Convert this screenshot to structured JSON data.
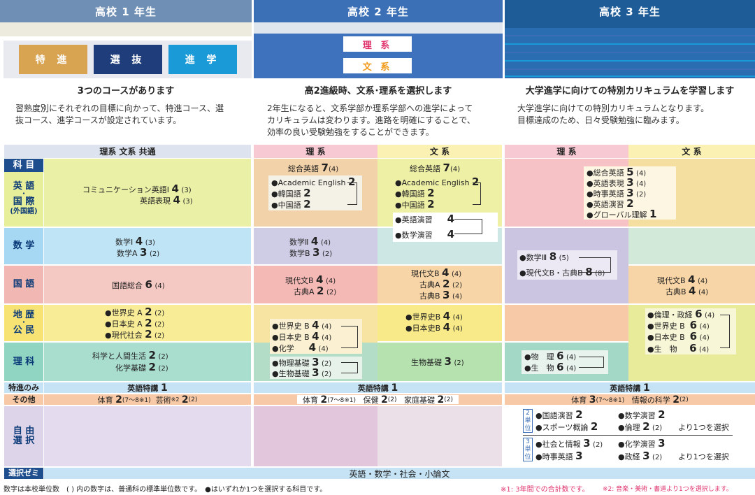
{
  "headers": [
    "高校 1 年生",
    "高校 2 年生",
    "高校 3 年生"
  ],
  "courses": [
    "特 進",
    "選 抜",
    "進 学"
  ],
  "tracks": {
    "rikei": "理 系",
    "bunkei": "文 系"
  },
  "intro": [
    {
      "title": "3つのコースがあります",
      "text": [
        "習熟度別にそれぞれの目標に向かって、特進コース、選",
        "抜コース、進学コースが設定されています。"
      ]
    },
    {
      "title": "高2進級時、文系･理系を選択します",
      "text": [
        "2年生になると、文系学部か理系学部への進学によって",
        "カリキュラムは変わります。進路を明確にすることで、",
        "効率の良い受験勉強をすることができます。"
      ]
    },
    {
      "title": "大学進学に向けての特別カリキュラムを学習します",
      "text": [
        "大学進学に向けての特別カリキュラムとなります。",
        "目標達成のため、日々受験勉強に臨みます。"
      ]
    }
  ],
  "table": {
    "g1_header": "理系 文系 共通",
    "rikei": "理 系",
    "bunkei": "文 系",
    "subject_header": "科 目",
    "subjects": {
      "english": [
        "英 語",
        "国 際",
        "(外国語)"
      ],
      "math": "数 学",
      "japanese": "国 語",
      "social": [
        "地 歴",
        "公 民"
      ],
      "science": "理 科",
      "tokushin": "特進のみ",
      "other": "その他",
      "free": [
        "自 由",
        "選 択"
      ],
      "seminar": "選択ゼミ"
    },
    "g1": {
      "english": [
        {
          "name": "コミュニケーション英語Ⅰ",
          "u": "4",
          "s": "(3)"
        },
        {
          "name": "英語表現",
          "u": "4",
          "s": "(3)"
        }
      ],
      "math": [
        {
          "name": "数学Ⅰ",
          "u": "4",
          "s": "(3)"
        },
        {
          "name": "数学A",
          "u": "3",
          "s": "(2)"
        }
      ],
      "japanese": [
        {
          "name": "国語総合",
          "u": "6",
          "s": "(4)"
        }
      ],
      "social": [
        {
          "name": "●世界史 A",
          "u": "2",
          "s": "(2)"
        },
        {
          "name": "●日本史 A",
          "u": "2",
          "s": "(2)"
        },
        {
          "name": "●現代社会",
          "u": "2",
          "s": "(2)"
        }
      ],
      "science": [
        {
          "name": "科学と人間生活",
          "u": "2",
          "s": "(2)"
        },
        {
          "name": "化学基礎",
          "u": "2",
          "s": "(2)"
        }
      ],
      "tokushin": {
        "name": "英語特講",
        "u": "1"
      },
      "other": {
        "a": "体育",
        "au": "2",
        "as": "(7〜8",
        "am": "※1",
        "ae": ")",
        "b": "芸術",
        "bm": "※2",
        "bu": "2",
        "bs": "(2)"
      }
    },
    "g2": {
      "r_english_top": {
        "name": "総合英語",
        "u": "7",
        "s": "(4)"
      },
      "r_english": [
        {
          "name": "●Academic English",
          "u": "2"
        },
        {
          "name": "●韓国語",
          "u": "2"
        },
        {
          "name": "●中国語",
          "u": "2"
        }
      ],
      "b_english_top": {
        "name": "総合英語",
        "u": "7",
        "s": "(4)"
      },
      "b_english": [
        {
          "name": "●Academic English",
          "u": "2"
        },
        {
          "name": "●韓国語",
          "u": "2"
        },
        {
          "name": "●中国語",
          "u": "2"
        }
      ],
      "b_english2": [
        {
          "name": "●英語演習",
          "u": "4"
        },
        {
          "name": "●数学演習",
          "u": "4"
        }
      ],
      "r_math": [
        {
          "name": "数学Ⅱ",
          "u": "4",
          "s": "(4)"
        },
        {
          "name": "数学B",
          "u": "3",
          "s": "(2)"
        }
      ],
      "r_japanese": [
        {
          "name": "現代文B",
          "u": "4",
          "s": "(4)"
        },
        {
          "name": "古典A",
          "u": "2",
          "s": "(2)"
        }
      ],
      "b_japanese": [
        {
          "name": "現代文B",
          "u": "4",
          "s": "(4)"
        },
        {
          "name": "古典A",
          "u": "2",
          "s": "(2)"
        },
        {
          "name": "古典B",
          "u": "3",
          "s": "(4)"
        }
      ],
      "b_social": [
        {
          "name": "●世界史B",
          "u": "4",
          "s": "(4)"
        },
        {
          "name": "●日本史B",
          "u": "4",
          "s": "(4)"
        }
      ],
      "r_social": [
        {
          "name": "●世界史 B",
          "u": "4",
          "s": "(4)"
        },
        {
          "name": "●日本史 B",
          "u": "4",
          "s": "(4)"
        },
        {
          "name": "●化学",
          "u": "4",
          "s": "(4)"
        }
      ],
      "r_science": [
        {
          "name": "●物理基礎",
          "u": "3",
          "s": "(2)"
        },
        {
          "name": "●生物基礎",
          "u": "3",
          "s": "(2)"
        }
      ],
      "b_science": {
        "name": "生物基礎",
        "u": "3",
        "s": "(2)"
      },
      "tokushin": {
        "name": "英語特講",
        "u": "1"
      },
      "other": {
        "a": "体育",
        "au": "2",
        "as": "(7〜8",
        "am": "※1",
        "ae": ")",
        "b": "保健",
        "bu": "2",
        "bs": "(2)",
        "c": "家庭基礎",
        "cu": "2",
        "cs": "(2)"
      }
    },
    "g3": {
      "english": [
        {
          "name": "●総合英語",
          "u": "5",
          "s": "(4)"
        },
        {
          "name": "●英語表現",
          "u": "3",
          "s": "(4)"
        },
        {
          "name": "●時事英語",
          "u": "3",
          "s": "(2)"
        },
        {
          "name": "●英語演習",
          "u": "2",
          "s": ""
        },
        {
          "name": "●グローバル理解",
          "u": "1",
          "s": ""
        }
      ],
      "r_math": [
        {
          "name": "●数学Ⅲ",
          "u": "8",
          "s": "(5)"
        },
        {
          "name": "●現代文B・古典B",
          "u": "8",
          "s": "(8)"
        }
      ],
      "b_japanese": [
        {
          "name": "現代文B",
          "u": "4",
          "s": "(4)"
        },
        {
          "name": "古典B",
          "u": "4",
          "s": "(4)"
        }
      ],
      "b_social": [
        {
          "name": "●倫理・政経",
          "u": "6",
          "s": "(4)"
        },
        {
          "name": "●世界史 B",
          "u": "6",
          "s": "(4)"
        },
        {
          "name": "●日本史 B",
          "u": "6",
          "s": "(4)"
        },
        {
          "name": "●生　物",
          "u": "6",
          "s": "(4)"
        }
      ],
      "r_science": [
        {
          "name": "●物　理",
          "u": "6",
          "s": "(4)"
        },
        {
          "name": "●生　物",
          "u": "6",
          "s": "(4)"
        }
      ],
      "tokushin": {
        "name": "英語特講",
        "u": "1"
      },
      "other": {
        "a": "体育",
        "au": "3",
        "as": "(7〜8",
        "am": "※1",
        "ae": ")",
        "b": "情報の科学",
        "bu": "2",
        "bs": "(2)"
      },
      "free1_tag": [
        "2",
        "単",
        "位"
      ],
      "free1": [
        {
          "name": "●国語演習",
          "u": "2",
          "s": ""
        },
        {
          "name": "●数学演習",
          "u": "2",
          "s": ""
        },
        {
          "name": "●スポーツ概論",
          "u": "2",
          "s": ""
        },
        {
          "name": "●倫理",
          "u": "2",
          "s": "(2)"
        }
      ],
      "free1_note": "より1つを選択",
      "free2_tag": [
        "3",
        "単",
        "位"
      ],
      "free2": [
        {
          "name": "●社会と情報",
          "u": "3",
          "s": "(2)"
        },
        {
          "name": "●化学演習",
          "u": "3",
          "s": ""
        },
        {
          "name": "●時事英語",
          "u": "3",
          "s": ""
        },
        {
          "name": "●政経",
          "u": "3",
          "s": "(2)"
        }
      ],
      "free2_note": "より1つを選択"
    },
    "seminar": "英語・数学・社会・小論文"
  },
  "footnotes": {
    "left": "数字は本校単位数　(   ) 内の数字は、普通科の標準単位数です。　●はいずれか1つを選択する科目です。",
    "right1": "※1: 3年間での合計数です。",
    "right2": "※2: 音楽・美術・書道より1つを選択します。"
  },
  "colors": {
    "g1": "#6f8fb5",
    "g2": "#3b6fb6",
    "g3": "#1d5c97",
    "tokushin": "#d8a452",
    "senbatsu": "#1f3d7a",
    "shingaku": "#1a9ad7",
    "rikei": "#e0336b",
    "bunkei": "#f29a1a"
  }
}
